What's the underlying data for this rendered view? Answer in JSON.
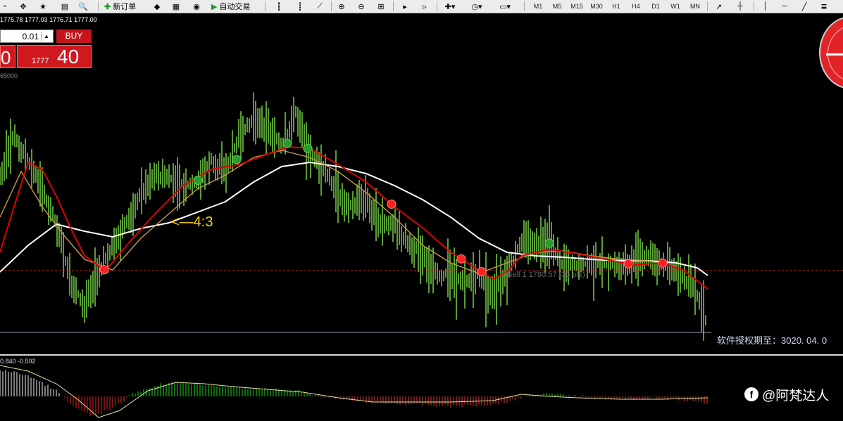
{
  "toolbar": {
    "new_order_label": "新订单",
    "auto_trading_label": "自动交易",
    "timeframes": [
      "M1",
      "M5",
      "M15",
      "M30",
      "H1",
      "H4",
      "D1",
      "W1",
      "MN"
    ]
  },
  "trade_panel": {
    "quote_line": "1776.78 1777.03 1776.71 1777.00",
    "lot_value": "0.01",
    "buy_label": "BUY",
    "sell_digits": "0",
    "buy_price_small": "1777",
    "buy_price_big": "40"
  },
  "chart": {
    "volume_label": "65000",
    "ratio_annotation": "<—4:3",
    "sell_line_label": "#Sell 1 1780.57 (33 pts)",
    "license_text": "软件授权期至：3020. 04. 0",
    "colors": {
      "bars": "#7fe04a",
      "slow_ma": "#ffffff",
      "fast_ma": "#e00000",
      "mid_ma": "#c79a4a",
      "level_line": "#c2271f",
      "support_line": "#9aa6b8",
      "red_marker": "#ff1f1f",
      "green_marker": "#2b9b2b"
    },
    "markers": {
      "red": 7,
      "green": 5
    }
  },
  "oscillator": {
    "label": "0.840 -0.502"
  },
  "watermark": {
    "text": "@阿梵达人"
  }
}
